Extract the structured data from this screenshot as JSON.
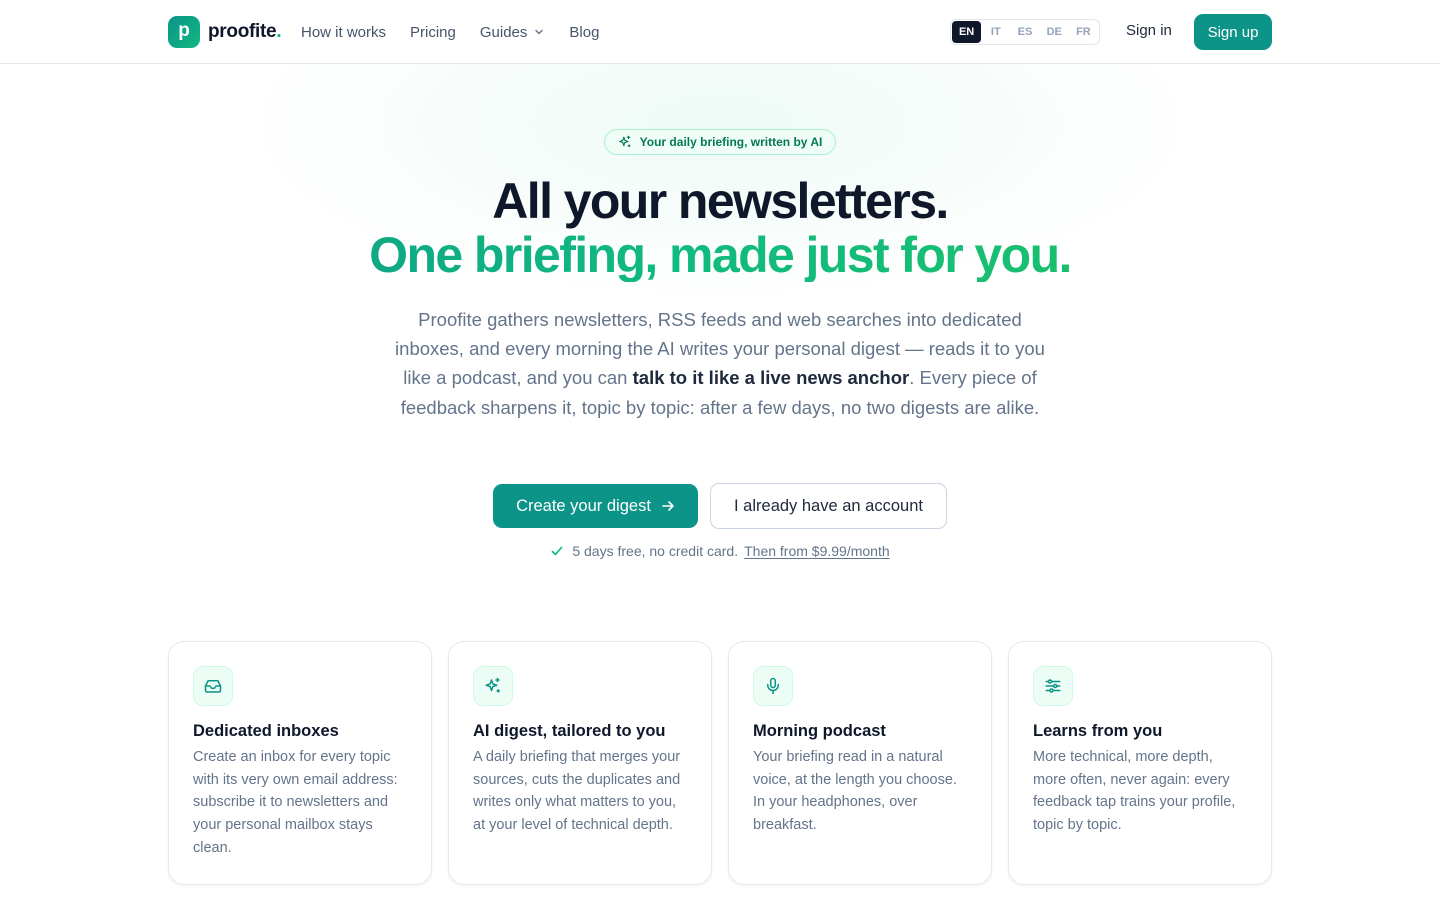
{
  "brand": {
    "logo_letter": "p",
    "name": "proofite",
    "dot": "."
  },
  "nav": {
    "links": [
      "How it works",
      "Pricing",
      "Guides",
      "Blog"
    ],
    "languages": [
      "EN",
      "IT",
      "ES",
      "DE",
      "FR"
    ],
    "active_language": "EN",
    "sign_in": "Sign in",
    "sign_up": "Sign up"
  },
  "hero": {
    "badge": "Your daily briefing, written by AI",
    "title_line1": "All your newsletters.",
    "title_line2": "One briefing, made just for you.",
    "desc_part1": "Proofite gathers newsletters, RSS feeds and web searches into dedicated inboxes, and every morning the AI writes your personal digest — reads it to you like a podcast, and you can ",
    "desc_bold": "talk to it like a live news anchor",
    "desc_part2": ". Every piece of feedback sharpens it, topic by topic: after a few days, no two digests are alike.",
    "cta_primary": "Create your digest",
    "cta_secondary": "I already have an account",
    "trial_text": "5 days free, no credit card.",
    "trial_link": "Then from $9.99/month"
  },
  "features": [
    {
      "icon": "inbox-icon",
      "title": "Dedicated inboxes",
      "desc": "Create an inbox for every topic with its very own email address: subscribe it to newsletters and your personal mailbox stays clean."
    },
    {
      "icon": "sparkles-icon",
      "title": "AI digest, tailored to you",
      "desc": "A daily briefing that merges your sources, cuts the duplicates and writes only what matters to you, at your level of technical depth."
    },
    {
      "icon": "microphone-icon",
      "title": "Morning podcast",
      "desc": "Your briefing read in a natural voice, at the length you choose. In your headphones, over breakfast."
    },
    {
      "icon": "sliders-icon",
      "title": "Learns from you",
      "desc": "More technical, more depth, more often, never again: every feedback tap trains your profile, topic by topic."
    }
  ],
  "colors": {
    "accent": "#0d9488",
    "accent_light": "#10b981",
    "text": "#0f172a",
    "muted": "#64748b"
  }
}
